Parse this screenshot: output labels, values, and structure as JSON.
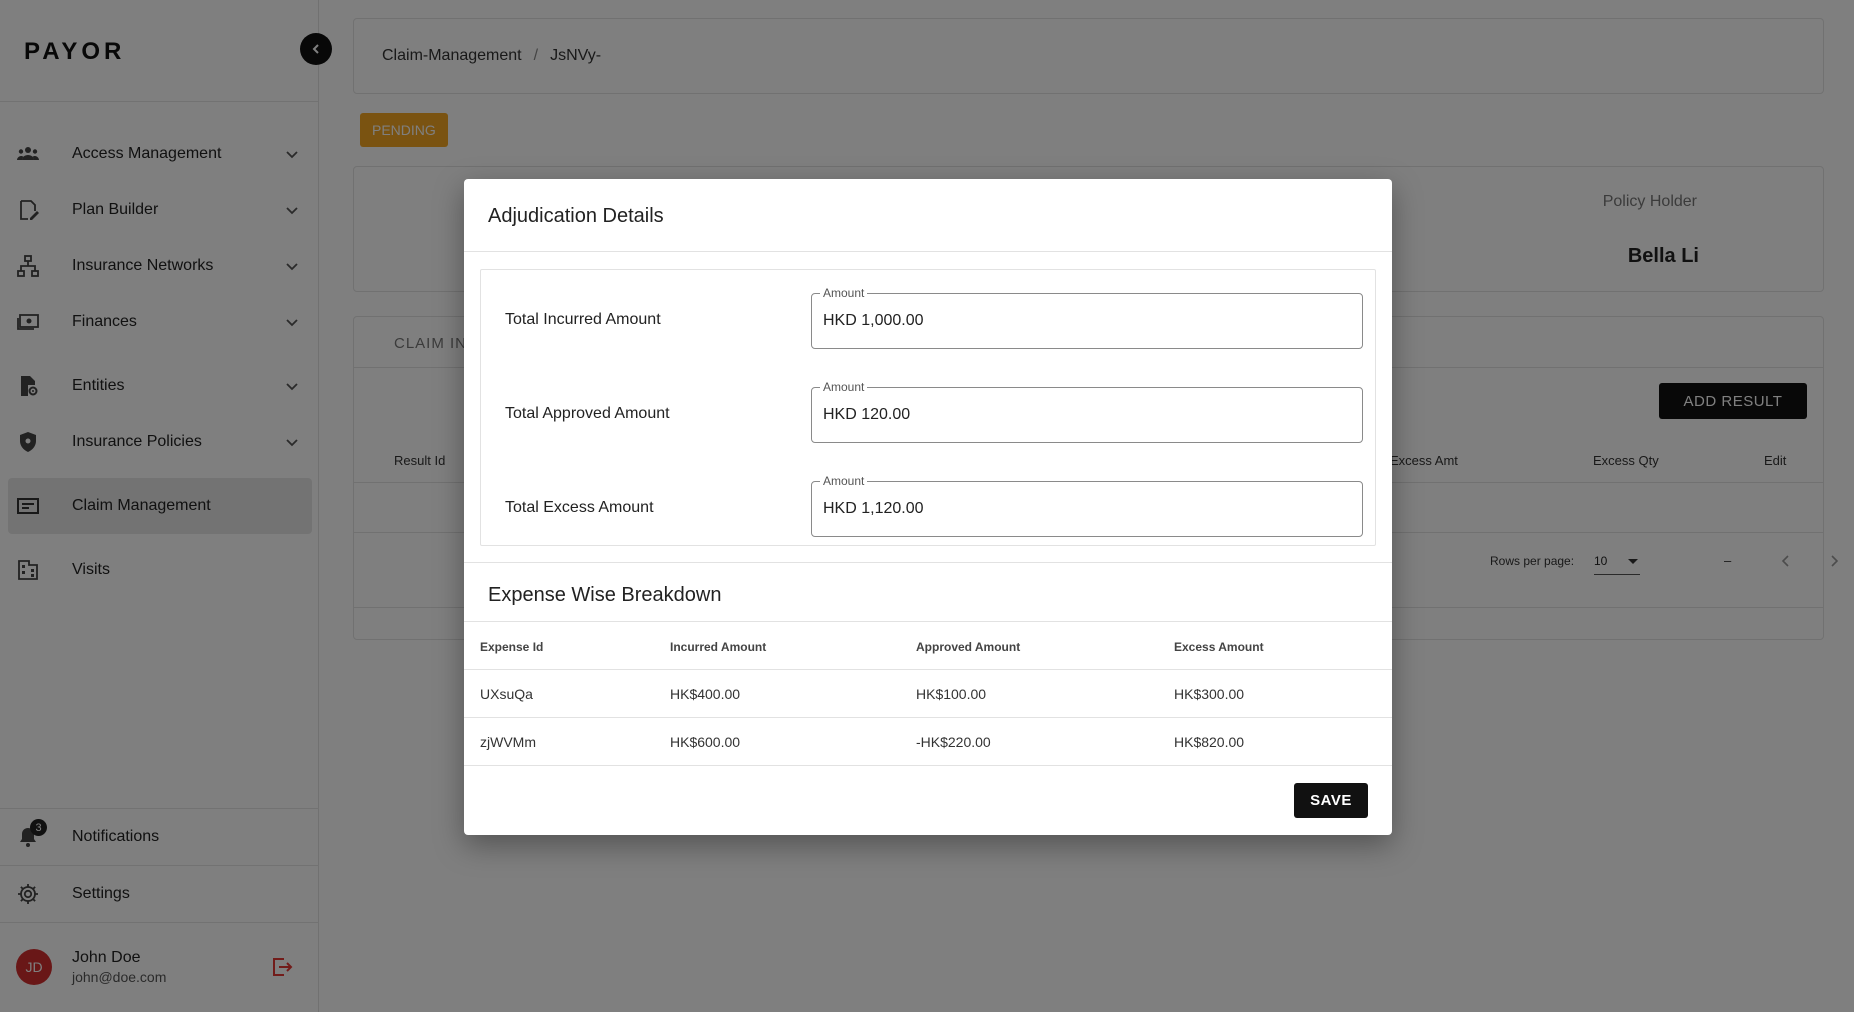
{
  "app": {
    "logo": "PAYOR"
  },
  "sidebar": {
    "items": [
      {
        "label": "Access Management",
        "icon": "people-icon",
        "expandable": true,
        "active": false
      },
      {
        "label": "Plan Builder",
        "icon": "plan-edit-icon",
        "expandable": true,
        "active": false
      },
      {
        "label": "Insurance Networks",
        "icon": "network-icon",
        "expandable": true,
        "active": false
      },
      {
        "label": "Finances",
        "icon": "money-icon",
        "expandable": true,
        "active": false
      },
      {
        "label": "Entities",
        "icon": "entity-settings-icon",
        "expandable": true,
        "active": false
      },
      {
        "label": "Insurance Policies",
        "icon": "shield-icon",
        "expandable": true,
        "active": false
      },
      {
        "label": "Claim Management",
        "icon": "card-icon",
        "expandable": false,
        "active": true
      },
      {
        "label": "Visits",
        "icon": "building-icon",
        "expandable": false,
        "active": false
      }
    ],
    "notifications": {
      "label": "Notifications",
      "count": "3"
    },
    "settings": {
      "label": "Settings"
    },
    "user": {
      "initials": "JD",
      "name": "John Doe",
      "email": "john@doe.com"
    }
  },
  "breadcrumb": {
    "section": "Claim-Management",
    "separator": "/",
    "current": "JsNVy-"
  },
  "status": "PENDING",
  "policy_holder": {
    "label": "Policy Holder",
    "name": "Bella Li"
  },
  "results": {
    "tab_label": "CLAIM IN",
    "add_button": "ADD RESULT",
    "columns": [
      "Result Id",
      "Excess Amt",
      "Excess Qty",
      "Edit"
    ],
    "rows_per_page_label": "Rows per page:",
    "rows_per_page_value": "10",
    "page_range": "–"
  },
  "modal": {
    "title": "Adjudication Details",
    "amounts": [
      {
        "label": "Total Incurred Amount",
        "legend": "Amount",
        "value": "HKD 1,000.00"
      },
      {
        "label": "Total Approved Amount",
        "legend": "Amount",
        "value": "HKD 120.00"
      },
      {
        "label": "Total Excess Amount",
        "legend": "Amount",
        "value": "HKD 1,120.00"
      }
    ],
    "breakdown_title": "Expense Wise Breakdown",
    "table": {
      "headers": [
        "Expense Id",
        "Incurred Amount",
        "Approved Amount",
        "Excess Amount"
      ],
      "rows": [
        [
          "UXsuQa",
          "HK$400.00",
          "HK$100.00",
          "HK$300.00"
        ],
        [
          "zjWVMm",
          "HK$600.00",
          "-HK$220.00",
          "HK$820.00"
        ]
      ]
    },
    "save_button": "SAVE"
  },
  "colors": {
    "status_pending": "#f5a623",
    "primary_button": "#111111",
    "avatar": "#d32f2f",
    "logout_icon": "#e53935"
  }
}
